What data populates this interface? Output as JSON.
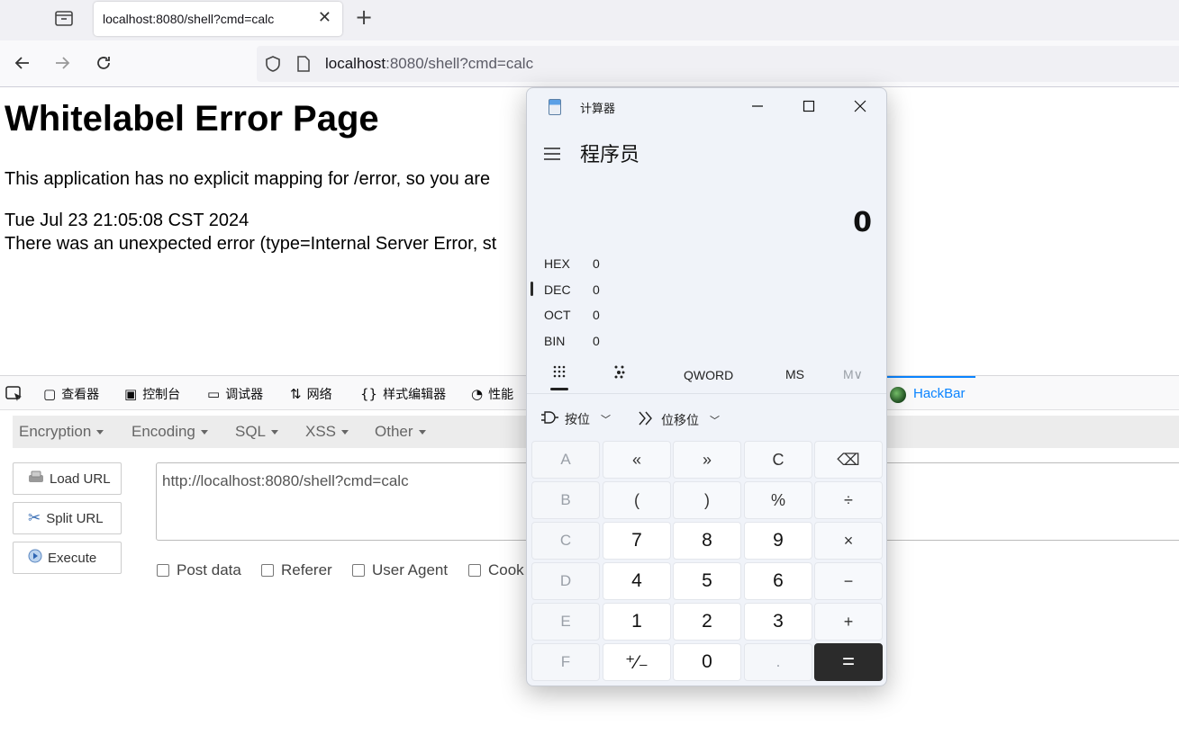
{
  "browser": {
    "tab_title": "localhost:8080/shell?cmd=calc",
    "tab_close": "✕",
    "new_tab": "+",
    "url_host": "localhost",
    "url_rest": ":8080/shell?cmd=calc"
  },
  "page": {
    "title": "Whitelabel Error Page",
    "line1": "This application has no explicit mapping for /error, so you are",
    "timestamp": "Tue Jul 23 21:05:08 CST 2024",
    "line3": "There was an unexpected error (type=Internal Server Error, st"
  },
  "devtools": {
    "tabs": [
      {
        "icon": "inspector-icon",
        "label": "查看器"
      },
      {
        "icon": "console-icon",
        "label": "控制台"
      },
      {
        "icon": "debugger-icon",
        "label": "调试器"
      },
      {
        "icon": "network-icon",
        "label": "网络"
      },
      {
        "icon": "style-editor-icon",
        "label": "样式编辑器"
      },
      {
        "icon": "performance-icon",
        "label": "性能"
      }
    ],
    "hackbar_label": "HackBar"
  },
  "hackbar": {
    "menus": [
      "Encryption",
      "Encoding",
      "SQL",
      "XSS",
      "Other"
    ],
    "buttons": {
      "load": "Load URL",
      "split": "Split URL",
      "execute": "Execute"
    },
    "url_value": "http://localhost:8080/shell?cmd=calc",
    "checkboxes": [
      "Post data",
      "Referer",
      "User Agent",
      "Cook"
    ]
  },
  "calculator": {
    "title": "计算器",
    "mode": "程序员",
    "display": "0",
    "radix": [
      {
        "name": "HEX",
        "value": "0"
      },
      {
        "name": "DEC",
        "value": "0"
      },
      {
        "name": "OCT",
        "value": "0"
      },
      {
        "name": "BIN",
        "value": "0"
      }
    ],
    "word_size": "QWORD",
    "ms": "MS",
    "mv": "M∨",
    "bitwise": "按位",
    "bitshift": "位移位",
    "keys": [
      [
        "A",
        "«",
        "»",
        "C",
        "⌫"
      ],
      [
        "B",
        "(",
        ")",
        "%",
        "÷"
      ],
      [
        "C",
        "7",
        "8",
        "9",
        "×"
      ],
      [
        "D",
        "4",
        "5",
        "6",
        "−"
      ],
      [
        "E",
        "1",
        "2",
        "3",
        "+"
      ],
      [
        "F",
        "⁺∕₋",
        "0",
        ".",
        "="
      ]
    ]
  }
}
